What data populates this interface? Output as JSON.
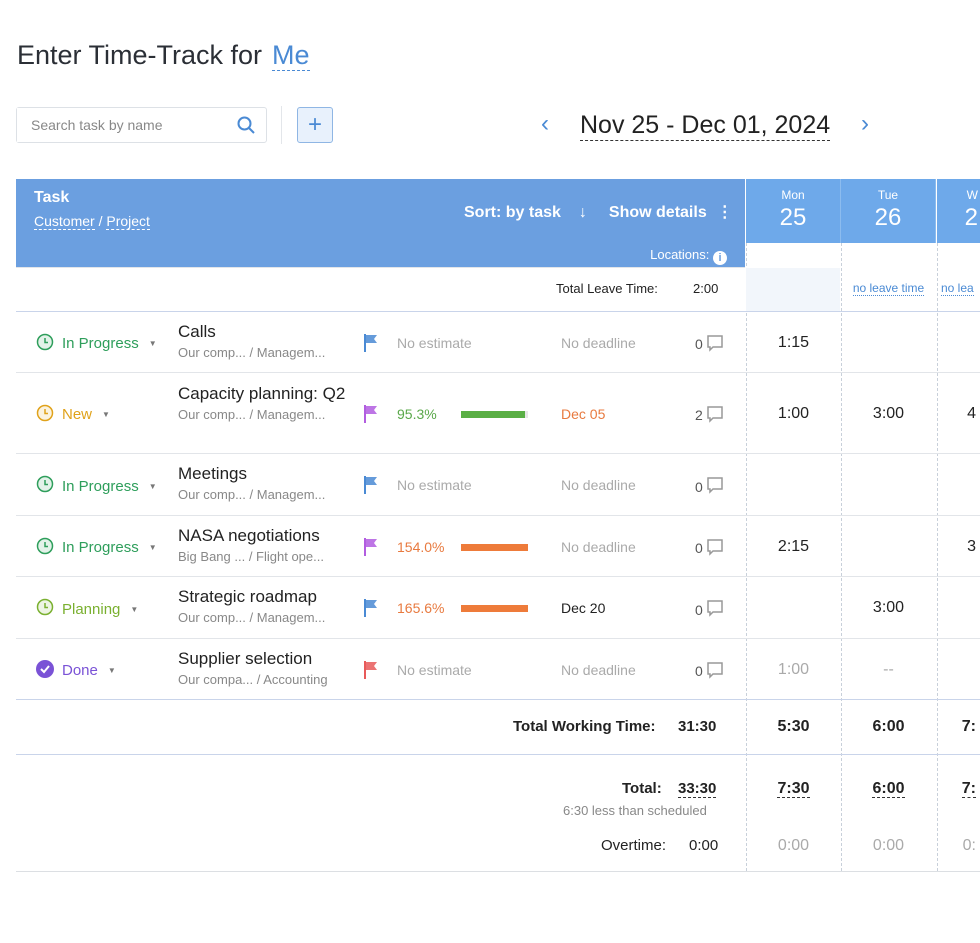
{
  "header": {
    "title": "Enter Time-Track for",
    "user": "Me"
  },
  "toolbar": {
    "search_placeholder": "Search task by name",
    "add_label": "+",
    "date_range": "Nov 25 - Dec 01, 2024",
    "prev": "‹",
    "next": "›"
  },
  "table": {
    "task_label": "Task",
    "customer_label": "Customer",
    "project_label": "Project",
    "sort_label": "Sort: by task",
    "sort_arrow": "↓",
    "show_details": "Show details",
    "more": "⋮",
    "locations_label": "Locations:",
    "header_color": "#6b9fe0"
  },
  "days": [
    {
      "name": "Mon",
      "date": "25",
      "leave": "2:00"
    },
    {
      "name": "Tue",
      "date": "26",
      "leave": "no leave time"
    },
    {
      "name": "W",
      "date": "2",
      "leave": "no lea"
    }
  ],
  "leave": {
    "label": "Total Leave Time:",
    "total": "2:00"
  },
  "tasks": [
    {
      "status": "In Progress",
      "status_color": "#2e9e5b",
      "name": "Calls",
      "sub": "Our comp...  / Managem...",
      "flag_color": "#4a8ad4",
      "estimate": "No estimate",
      "estimate_color": "#aaa",
      "progress": null,
      "deadline": "No deadline",
      "deadline_color": "#aaa",
      "comments": "0",
      "times": [
        "1:15",
        "",
        ""
      ]
    },
    {
      "status": "New",
      "status_color": "#e0a21a",
      "name": "Capacity planning: Q2",
      "sub": "Our comp...  / Managem...",
      "flag_color": "#b25de0",
      "estimate": "95.3%",
      "estimate_color": "#5aa84a",
      "progress": 95.3,
      "bar_color": "#5aaf45",
      "deadline": "Dec 05",
      "deadline_color": "#e87a3f",
      "comments": "2",
      "times": [
        "1:00",
        "3:00",
        "4"
      ]
    },
    {
      "status": "In Progress",
      "status_color": "#2e9e5b",
      "name": "Meetings",
      "sub": "Our comp...  / Managem...",
      "flag_color": "#4a8ad4",
      "estimate": "No estimate",
      "estimate_color": "#aaa",
      "progress": null,
      "deadline": "No deadline",
      "deadline_color": "#aaa",
      "comments": "0",
      "times": [
        "",
        "",
        ""
      ]
    },
    {
      "status": "In Progress",
      "status_color": "#2e9e5b",
      "name": "NASA negotiations",
      "sub": "Big Bang ...  / Flight ope...",
      "flag_color": "#b25de0",
      "estimate": "154.0%",
      "estimate_color": "#e87a3f",
      "progress": 154.0,
      "bar_color": "#ee7b3a",
      "deadline": "No deadline",
      "deadline_color": "#aaa",
      "comments": "0",
      "times": [
        "2:15",
        "",
        "3"
      ]
    },
    {
      "status": "Planning",
      "status_color": "#7ab030",
      "name": "Strategic roadmap",
      "sub": "Our comp...  / Managem...",
      "flag_color": "#4a8ad4",
      "estimate": "165.6%",
      "estimate_color": "#e87a3f",
      "progress": 165.6,
      "bar_color": "#ee7b3a",
      "deadline": "Dec 20",
      "deadline_color": "#222",
      "comments": "0",
      "times": [
        "",
        "3:00",
        ""
      ]
    },
    {
      "status": "Done",
      "status_color": "#7a52d6",
      "name": "Supplier selection",
      "sub": "Our compa... / Accounting",
      "flag_color": "#e85a5a",
      "estimate": "No estimate",
      "estimate_color": "#aaa",
      "progress": null,
      "deadline": "No deadline",
      "deadline_color": "#aaa",
      "comments": "0",
      "times": [
        "1:00",
        "--",
        ""
      ],
      "times_gray": true
    }
  ],
  "totals": {
    "working_label": "Total Working Time:",
    "working": "31:30",
    "working_days": [
      "5:30",
      "6:00",
      "7:"
    ],
    "total_label": "Total:",
    "total": "33:30",
    "total_days": [
      "7:30",
      "6:00",
      "7:"
    ],
    "scheduled_note": "6:30 less than scheduled",
    "overtime_label": "Overtime:",
    "overtime": "0:00",
    "overtime_days": [
      "0:00",
      "0:00",
      "0:"
    ]
  }
}
